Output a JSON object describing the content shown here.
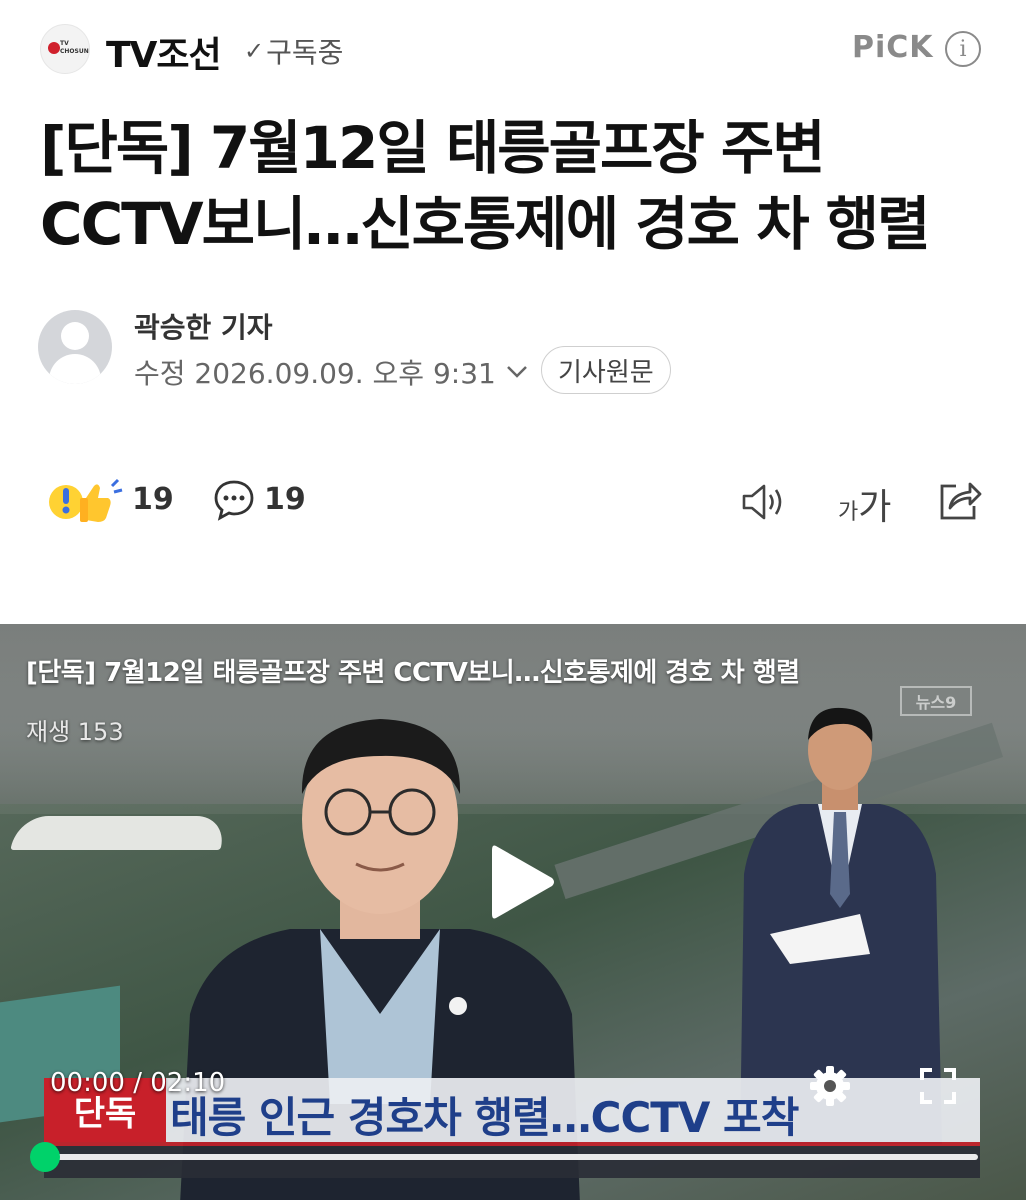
{
  "header": {
    "logo_text": "TV CHOSUN",
    "press_name": "TV조선",
    "subscribe_label": "구독중",
    "pick_label": "PiCK",
    "info_symbol": "i"
  },
  "article": {
    "title": "[단독] 7월12일 태릉골프장 주변 CCTV보니…신호통제에 경호 차 행렬",
    "reporter": "곽승한 기자",
    "dateline": "수정 2026.09.09. 오후 9:31",
    "original_button": "기사원문"
  },
  "actions": {
    "reaction_count": "19",
    "comment_count": "19",
    "font_small": "가",
    "font_large": "가"
  },
  "video": {
    "title": "[단독] 7월12일 태릉골프장 주변 CCTV보니…신호통제에 경호 차 행렬",
    "plays": "재생 153",
    "channel_bug": "뉴스9",
    "lower_tag": "단독",
    "lower_headline": "태릉 인근 경호차 행렬…CCTV 포착",
    "time_current": "00:00",
    "time_total": "02:10",
    "progress": 0
  },
  "colors": {
    "accent_green": "#00d26a",
    "brand_red": "#d0202c",
    "headline_blue": "#1f3f8a"
  }
}
